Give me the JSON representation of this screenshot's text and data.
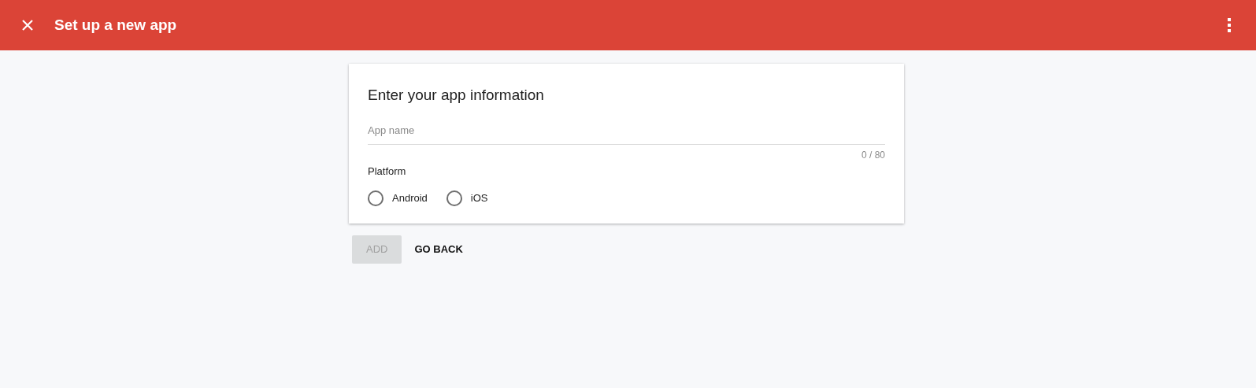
{
  "header": {
    "title": "Set up a new app"
  },
  "card": {
    "title": "Enter your app information",
    "app_name": {
      "placeholder": "App name",
      "counter": "0 / 80"
    },
    "platform_label": "Platform",
    "platforms": [
      {
        "label": "Android",
        "selected": false
      },
      {
        "label": "iOS",
        "selected": false
      }
    ]
  },
  "buttons": [
    {
      "label": "ADD",
      "disabled": true
    },
    {
      "label": "GO BACK",
      "disabled": false
    }
  ]
}
